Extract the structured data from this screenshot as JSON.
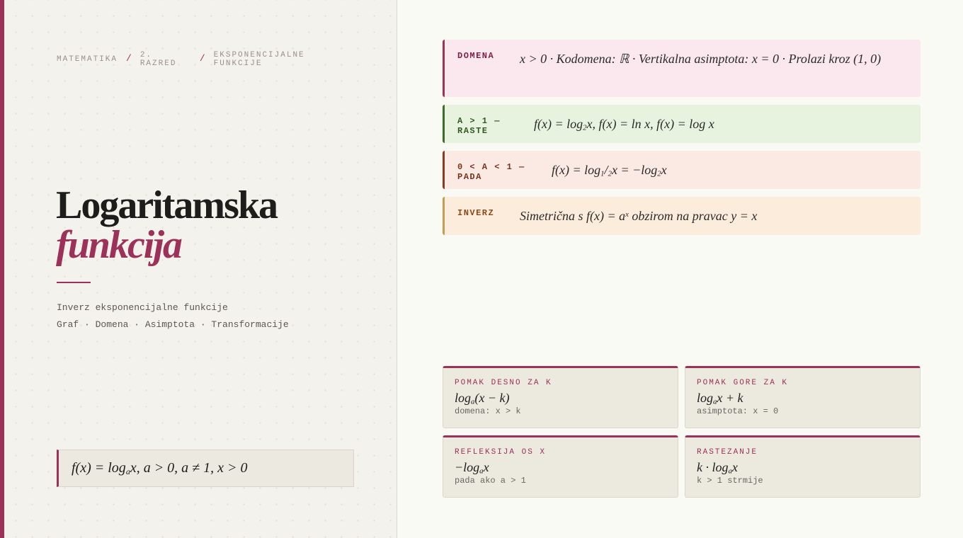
{
  "breadcrumb": {
    "items": [
      "MATEMATIKA",
      "2. RAZRED",
      "EKSPONENCIJALNE FUNKCIJE"
    ],
    "separator": "/"
  },
  "title": {
    "line1": "Logaritamska",
    "line2": "funkcija"
  },
  "subtitle": {
    "line1": "Inverz eksponencijalne funkcije",
    "line2": "Graf · Domena · Asimptota · Transformacije"
  },
  "definition": {
    "f": "f(x) = log",
    "base": "a",
    "rest": "x,  a > 0,  a ≠ 1,  x > 0"
  },
  "properties": {
    "domena": {
      "tag": "DOMENA",
      "text": "x > 0  ·  Kodomena: ℝ  ·  Vertikalna asimptota: x = 0  ·  Prolazi kroz (1, 0)"
    },
    "raste": {
      "tag": "A > 1 — RASTE",
      "p1": "f(x) = log",
      "p1_sub": "2",
      "p2": "x,  f(x) = ln x,  f(x) = log x"
    },
    "pada": {
      "tag": "0 < A < 1 — PADA",
      "p1": "f(x) = log",
      "p1_sub1": "1",
      "p1_slash": "/",
      "p1_sub2": "2",
      "p2": "x  =  −log",
      "p2_sub": "2",
      "p3": "x"
    },
    "inverz": {
      "tag": "INVERZ",
      "p1": "Simetrična s f(x) = a",
      "p1_sup": "x",
      "p2": " obzirom na pravac y = x"
    }
  },
  "transformations": [
    {
      "label": "POMAK DESNO ZA K",
      "f1": "log",
      "f_sub": "a",
      "f2": "(x − k)",
      "note": "domena: x > k"
    },
    {
      "label": "POMAK GORE ZA K",
      "f1": "log",
      "f_sub": "a",
      "f2": "x + k",
      "note": "asimptota: x = 0"
    },
    {
      "label": "REFLEKSIJA OS X",
      "f1": "−log",
      "f_sub": "a",
      "f2": "x",
      "note": "pada ako a > 1"
    },
    {
      "label": "RASTEZANJE",
      "f1": "k · log",
      "f_sub": "a",
      "f2": "x",
      "note": "k > 1 strmije"
    }
  ],
  "colors": {
    "accent": "#9c3159",
    "domena_bg": "#fae8ee",
    "raste_bg": "#e8f3df",
    "pada_bg": "#fbe9e4",
    "inverz_bg": "#fcecdb"
  }
}
